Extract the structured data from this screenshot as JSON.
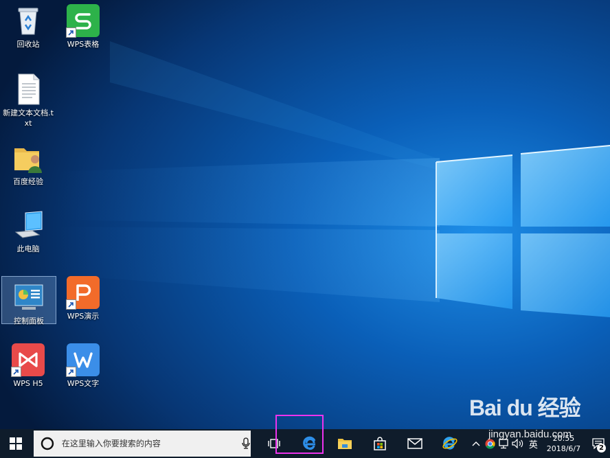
{
  "desktop": {
    "icons": [
      {
        "label": "回收站"
      },
      {
        "label": "WPS表格"
      },
      {
        "label": "新建文本文档.txt"
      },
      {
        "label": "百度经验"
      },
      {
        "label": "此电脑"
      },
      {
        "label": "控制面板"
      },
      {
        "label": "WPS演示"
      },
      {
        "label": "WPS H5"
      },
      {
        "label": "WPS文字"
      }
    ]
  },
  "taskbar": {
    "search_placeholder": "在这里输入你要搜索的内容",
    "pinned": [
      "task-view-icon",
      "edge-icon",
      "file-explorer-icon",
      "store-icon",
      "mail-icon",
      "internet-explorer-icon"
    ],
    "tray": {
      "ime": "英",
      "time": "20:55",
      "date": "2018/6/7",
      "notification_count": "2"
    }
  },
  "watermark": {
    "logo": "Bai du 经验",
    "url": "jingyan.baidu.com"
  },
  "colors": {
    "taskbar_bg": "#0f1c2b",
    "highlight": "#ee33ee",
    "wps_green": "#2db24a",
    "wps_orange": "#f26b2a",
    "wps_red": "#e84a4a",
    "wps_blue": "#3b8ee8"
  }
}
